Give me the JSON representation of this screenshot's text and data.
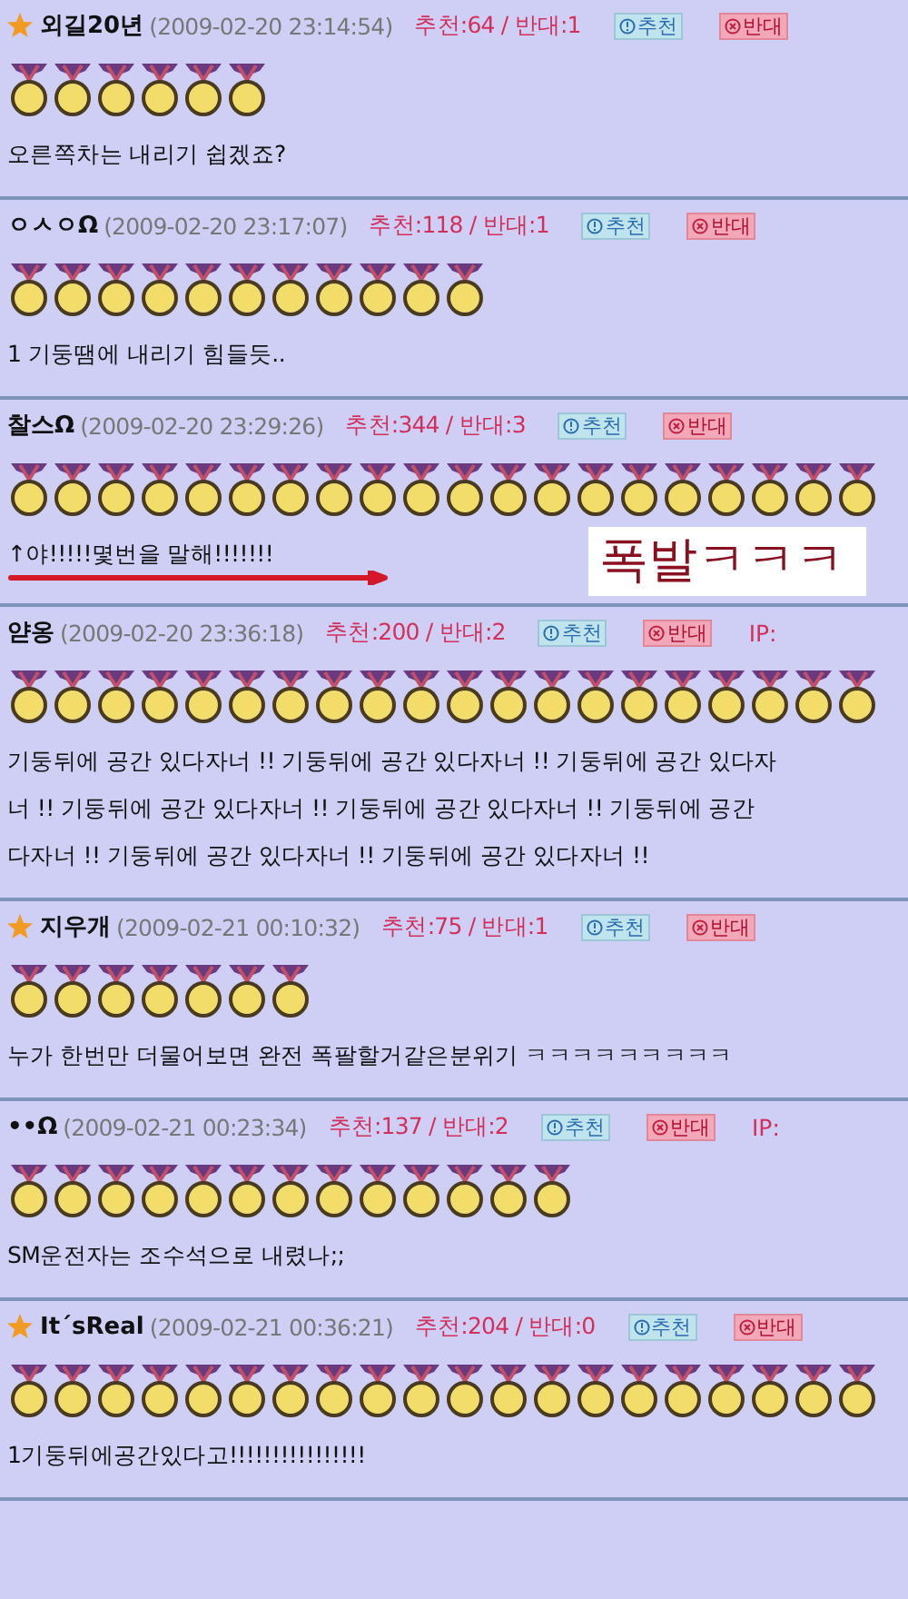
{
  "comments": [
    {
      "starred": true,
      "author": "외길20년",
      "date": "(2009-02-20 23:14:54)",
      "votes": "추천:64 / 반대:1",
      "recommend": "추천",
      "oppose": "반대",
      "medals": [
        {
          "kind": "gold"
        },
        {
          "kind": "gold"
        },
        {
          "kind": "gold"
        },
        {
          "kind": "gold"
        },
        {
          "kind": "gold"
        },
        {
          "kind": "gold"
        }
      ],
      "lines": [
        "오른쪽차는 내리기 쉽겠죠?"
      ]
    },
    {
      "starred": false,
      "author": "ㅇㅅㅇΩ",
      "date": "(2009-02-20 23:17:07)",
      "votes": "추천:118 / 반대:1",
      "recommend": "추천",
      "oppose": "반대",
      "medals": [
        {
          "kind": "gold"
        },
        {
          "kind": "gold"
        },
        {
          "kind": "gold"
        },
        {
          "kind": "gold"
        },
        {
          "kind": "gold"
        },
        {
          "kind": "gold"
        },
        {
          "kind": "gold"
        },
        {
          "kind": "gold"
        },
        {
          "kind": "gold"
        },
        {
          "kind": "gold"
        },
        {
          "kind": "gold"
        }
      ],
      "lines": [
        "1 기둥땜에 내리기 힘들듯.."
      ]
    },
    {
      "starred": false,
      "author": "찰스Ω",
      "date": "(2009-02-20 23:29:26)",
      "votes": "추천:344 / 반대:3",
      "recommend": "추천",
      "oppose": "반대",
      "medals": [
        {
          "kind": "gold"
        },
        {
          "kind": "gold"
        },
        {
          "kind": "gold"
        },
        {
          "kind": "gold"
        },
        {
          "kind": "gold"
        },
        {
          "kind": "gold"
        },
        {
          "kind": "gold"
        },
        {
          "kind": "gold"
        },
        {
          "kind": "gold"
        },
        {
          "kind": "gold"
        },
        {
          "kind": "gold"
        },
        {
          "kind": "gold"
        },
        {
          "kind": "gold"
        },
        {
          "kind": "gold"
        },
        {
          "kind": "gold"
        },
        {
          "kind": "gold"
        },
        {
          "kind": "gold"
        },
        {
          "kind": "gold"
        },
        {
          "kind": "gold"
        },
        {
          "kind": "gold"
        }
      ],
      "lines": [
        "↑야!!!!!몇번을 말해!!!!!!!"
      ],
      "annotation": {
        "caption": "폭발ㅋㅋㅋ",
        "arrow": true
      }
    },
    {
      "starred": false,
      "author": "얃옹",
      "date": "(2009-02-20 23:36:18)",
      "votes": "추천:200 / 반대:2",
      "recommend": "추천",
      "oppose": "반대",
      "ip": "IP:",
      "medals": [
        {
          "kind": "gold"
        },
        {
          "kind": "gold"
        },
        {
          "kind": "gold"
        },
        {
          "kind": "gold"
        },
        {
          "kind": "gold"
        },
        {
          "kind": "gold"
        },
        {
          "kind": "gold"
        },
        {
          "kind": "gold"
        },
        {
          "kind": "gold"
        },
        {
          "kind": "gold"
        },
        {
          "kind": "gold"
        },
        {
          "kind": "gold"
        },
        {
          "kind": "gold"
        },
        {
          "kind": "gold"
        },
        {
          "kind": "gold"
        },
        {
          "kind": "gold"
        },
        {
          "kind": "gold"
        },
        {
          "kind": "gold"
        },
        {
          "kind": "gold"
        },
        {
          "kind": "gold"
        }
      ],
      "lines": [
        "기둥뒤에 공간 있다자너 !! 기둥뒤에 공간 있다자너 !! 기둥뒤에 공간 있다자",
        "너 !! 기둥뒤에 공간 있다자너 !! 기둥뒤에 공간 있다자너 !! 기둥뒤에 공간",
        "다자너 !! 기둥뒤에 공간 있다자너 !! 기둥뒤에 공간 있다자너 !!"
      ]
    },
    {
      "starred": true,
      "author": "지우개",
      "date": "(2009-02-21 00:10:32)",
      "votes": "추천:75 / 반대:1",
      "recommend": "추천",
      "oppose": "반대",
      "medals": [
        {
          "kind": "gold"
        },
        {
          "kind": "gold"
        },
        {
          "kind": "gold"
        },
        {
          "kind": "gold"
        },
        {
          "kind": "gold"
        },
        {
          "kind": "gold"
        },
        {
          "kind": "gold"
        }
      ],
      "lines": [
        "누가 한번만 더물어보면 완전 폭팔할거같은분위기 ㅋㅋㅋㅋㅋㅋㅋㅋㅋ"
      ]
    },
    {
      "starred": false,
      "author": "••Ω",
      "date": "(2009-02-21 00:23:34)",
      "votes": "추천:137 / 반대:2",
      "recommend": "추천",
      "oppose": "반대",
      "ip": "IP:",
      "medals": [
        {
          "kind": "gold"
        },
        {
          "kind": "gold"
        },
        {
          "kind": "gold"
        },
        {
          "kind": "gold"
        },
        {
          "kind": "gold"
        },
        {
          "kind": "gold"
        },
        {
          "kind": "gold"
        },
        {
          "kind": "gold"
        },
        {
          "kind": "gold"
        },
        {
          "kind": "gold"
        },
        {
          "kind": "gold"
        },
        {
          "kind": "gold"
        },
        {
          "kind": "gold"
        }
      ],
      "lines": [
        "SM운전자는 조수석으로 내렸나;;"
      ]
    },
    {
      "starred": true,
      "author": "It´sReal",
      "date": "(2009-02-21 00:36:21)",
      "votes": "추천:204 / 반대:0",
      "recommend": "추천",
      "oppose": "반대",
      "medals": [
        {
          "kind": "gold"
        },
        {
          "kind": "gold"
        },
        {
          "kind": "gold"
        },
        {
          "kind": "gold"
        },
        {
          "kind": "gold"
        },
        {
          "kind": "gold"
        },
        {
          "kind": "gold"
        },
        {
          "kind": "gold"
        },
        {
          "kind": "gold"
        },
        {
          "kind": "gold"
        },
        {
          "kind": "gold"
        },
        {
          "kind": "gold"
        },
        {
          "kind": "gold"
        },
        {
          "kind": "gold"
        },
        {
          "kind": "gold"
        },
        {
          "kind": "gold"
        },
        {
          "kind": "gold"
        },
        {
          "kind": "gold"
        },
        {
          "kind": "gold"
        },
        {
          "kind": "gold"
        }
      ],
      "lines": [
        "1기둥뒤에공간있다고!!!!!!!!!!!!!!!!"
      ]
    }
  ]
}
